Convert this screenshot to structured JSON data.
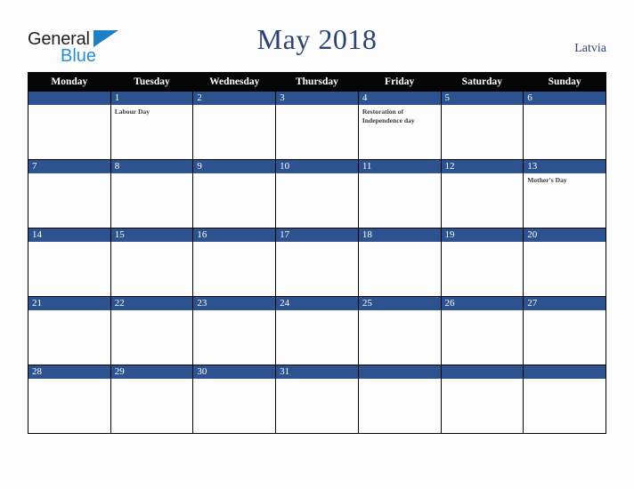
{
  "brand": {
    "name_part1": "General",
    "name_part2": "Blue",
    "triangle_icon": "triangle-icon"
  },
  "header": {
    "title": "May 2018",
    "country": "Latvia"
  },
  "colors": {
    "title": "#2d4371",
    "date_bar": "#2d5290",
    "dow_header_bg": "#050505",
    "brand_blue": "#2b8fd4",
    "page_bg": "#fdfdfd",
    "event_text": "#3a3a3a"
  },
  "calendar": {
    "month": "May",
    "year": "2018",
    "weekday_headers": [
      "Monday",
      "Tuesday",
      "Wednesday",
      "Thursday",
      "Friday",
      "Saturday",
      "Sunday"
    ],
    "weeks": [
      [
        {
          "date": "",
          "events": []
        },
        {
          "date": "1",
          "events": [
            "Labour Day"
          ]
        },
        {
          "date": "2",
          "events": []
        },
        {
          "date": "3",
          "events": []
        },
        {
          "date": "4",
          "events": [
            "Restoration of Independence day"
          ]
        },
        {
          "date": "5",
          "events": []
        },
        {
          "date": "6",
          "events": []
        }
      ],
      [
        {
          "date": "7",
          "events": []
        },
        {
          "date": "8",
          "events": []
        },
        {
          "date": "9",
          "events": []
        },
        {
          "date": "10",
          "events": []
        },
        {
          "date": "11",
          "events": []
        },
        {
          "date": "12",
          "events": []
        },
        {
          "date": "13",
          "events": [
            "Mother's Day"
          ]
        }
      ],
      [
        {
          "date": "14",
          "events": []
        },
        {
          "date": "15",
          "events": []
        },
        {
          "date": "16",
          "events": []
        },
        {
          "date": "17",
          "events": []
        },
        {
          "date": "18",
          "events": []
        },
        {
          "date": "19",
          "events": []
        },
        {
          "date": "20",
          "events": []
        }
      ],
      [
        {
          "date": "21",
          "events": []
        },
        {
          "date": "22",
          "events": []
        },
        {
          "date": "23",
          "events": []
        },
        {
          "date": "24",
          "events": []
        },
        {
          "date": "25",
          "events": []
        },
        {
          "date": "26",
          "events": []
        },
        {
          "date": "27",
          "events": []
        }
      ],
      [
        {
          "date": "28",
          "events": []
        },
        {
          "date": "29",
          "events": []
        },
        {
          "date": "30",
          "events": []
        },
        {
          "date": "31",
          "events": []
        },
        {
          "date": "",
          "events": []
        },
        {
          "date": "",
          "events": []
        },
        {
          "date": "",
          "events": []
        }
      ]
    ]
  }
}
